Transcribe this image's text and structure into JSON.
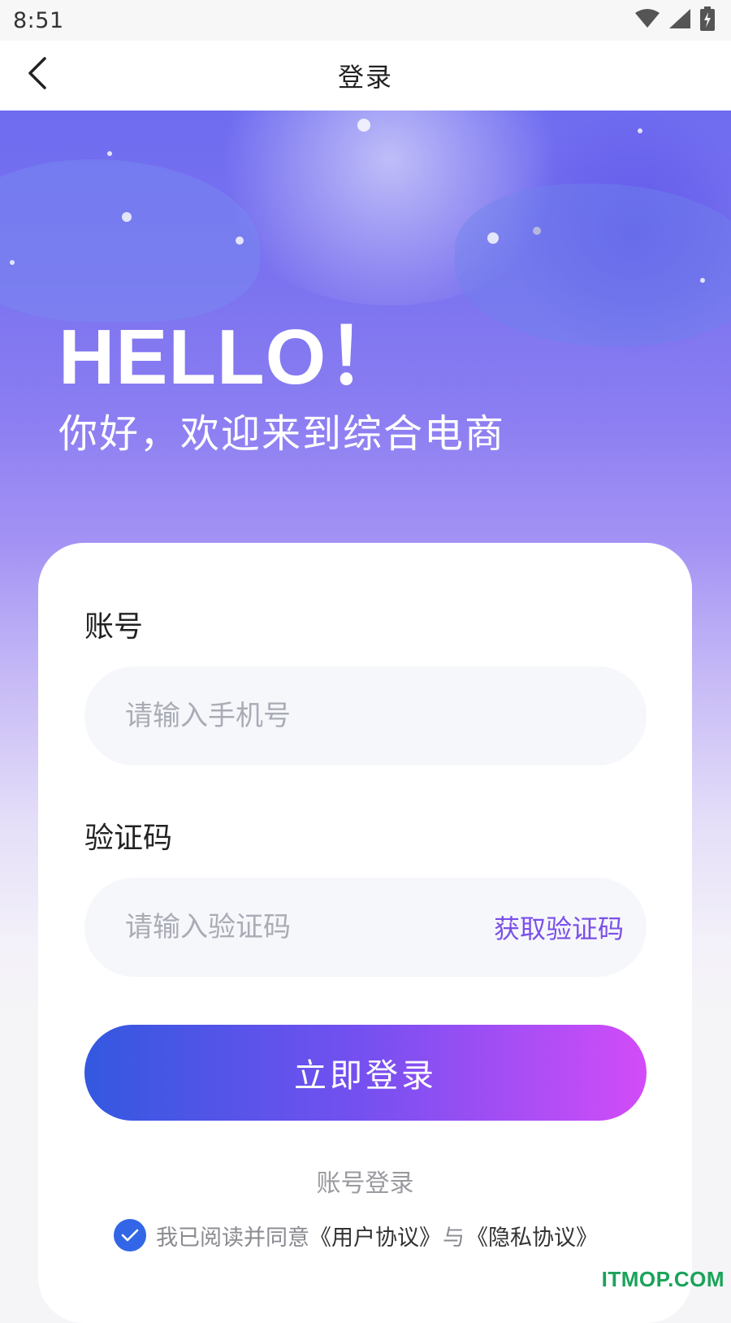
{
  "status_bar": {
    "time": "8:51",
    "icons": [
      "wifi-icon",
      "signal-icon",
      "battery-charging-icon"
    ]
  },
  "nav": {
    "title": "登录",
    "back_icon": "chevron-left-icon"
  },
  "hero": {
    "greeting": "HELLO！",
    "subtitle": "你好，欢迎来到综合电商"
  },
  "form": {
    "account_label": "账号",
    "account_placeholder": "请输入手机号",
    "code_label": "验证码",
    "code_placeholder": "请输入验证码",
    "get_code_label": "获取验证码",
    "submit_label": "立即登录",
    "switch_mode_label": "账号登录"
  },
  "agreement": {
    "checked": true,
    "prefix": "我已阅读并同意",
    "user_agreement": "《用户协议》",
    "conjunction": "与",
    "privacy_policy": "《隐私协议》"
  },
  "watermark": "ITMOP.COM",
  "colors": {
    "accent": "#7a50e8",
    "check": "#3366e6",
    "button_start": "#3358e0",
    "button_end": "#d24cf8"
  }
}
